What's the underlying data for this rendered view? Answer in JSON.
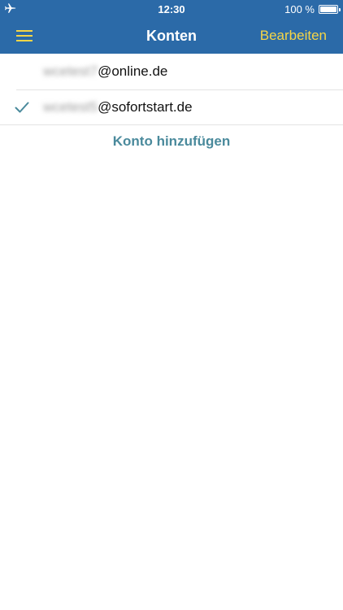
{
  "status": {
    "time": "12:30",
    "battery": "100 %",
    "airplane_icon": "airplane-icon",
    "battery_icon": "battery-icon"
  },
  "nav": {
    "title": "Konten",
    "edit_label": "Bearbeiten",
    "menu_icon": "hamburger-menu-icon"
  },
  "accounts": [
    {
      "user": "wcetest7",
      "domain": "@online.de",
      "selected": false
    },
    {
      "user": "wcetest5",
      "domain": "@sofortstart.de",
      "selected": true
    }
  ],
  "add_account_label": "Konto hinzufügen",
  "colors": {
    "header_bg": "#2b6aa8",
    "edit_accent": "#f5d547",
    "link_accent": "#4a8a9c"
  }
}
